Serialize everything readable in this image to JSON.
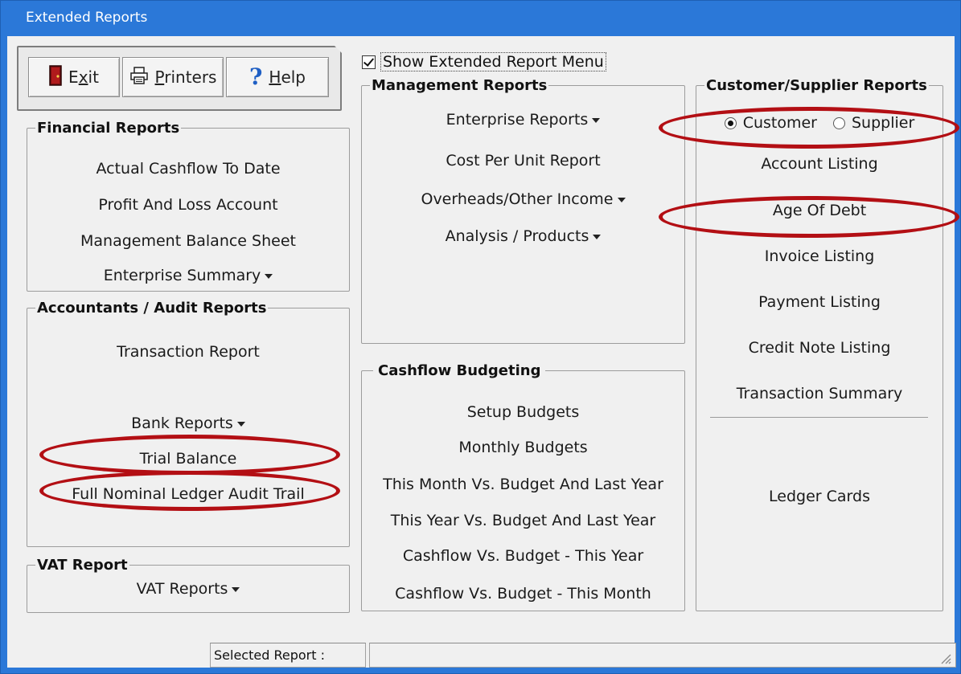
{
  "window": {
    "title": "Extended Reports"
  },
  "toolbar": {
    "exit": {
      "pre": "E",
      "u": "x",
      "post": "it"
    },
    "printers": {
      "pre": "",
      "u": "P",
      "post": "rinters"
    },
    "help": {
      "pre": "",
      "u": "H",
      "post": "elp"
    }
  },
  "show_extended_menu": {
    "label": "Show Extended Report Menu",
    "checked": true
  },
  "financial": {
    "title": "Financial Reports",
    "items": [
      "Actual Cashflow To Date",
      "Profit And Loss Account",
      "Management Balance Sheet",
      "Enterprise Summary"
    ]
  },
  "accountants": {
    "title": "Accountants / Audit Reports",
    "items": [
      "Transaction Report",
      "Bank Reports",
      "Trial Balance",
      "Full Nominal Ledger Audit Trail"
    ]
  },
  "vat": {
    "title": "VAT Report",
    "items": [
      "VAT Reports"
    ]
  },
  "management": {
    "title": "Management Reports",
    "items": [
      "Enterprise Reports",
      "Cost Per Unit Report",
      "Overheads/Other Income",
      "Analysis / Products"
    ]
  },
  "cashflow": {
    "title": "Cashflow Budgeting",
    "items": [
      "Setup Budgets",
      "Monthly Budgets",
      "This Month Vs. Budget And Last Year",
      "This Year Vs. Budget And Last Year",
      "Cashflow Vs. Budget - This Year",
      "Cashflow Vs. Budget - This Month"
    ]
  },
  "customer_supplier": {
    "title": "Customer/Supplier Reports",
    "radio": {
      "customer": "Customer",
      "supplier": "Supplier",
      "selected": "customer"
    },
    "items": [
      "Account Listing",
      "Age Of Debt",
      "Invoice Listing",
      "Payment Listing",
      "Credit Note Listing",
      "Transaction Summary",
      "Ledger Cards"
    ]
  },
  "status": {
    "selected_report_label": "Selected Report :",
    "selected_report_value": ""
  },
  "colors": {
    "titlebar": "#2b78d8",
    "highlight_ring": "#b30f14",
    "client": "#f0f0f0"
  }
}
